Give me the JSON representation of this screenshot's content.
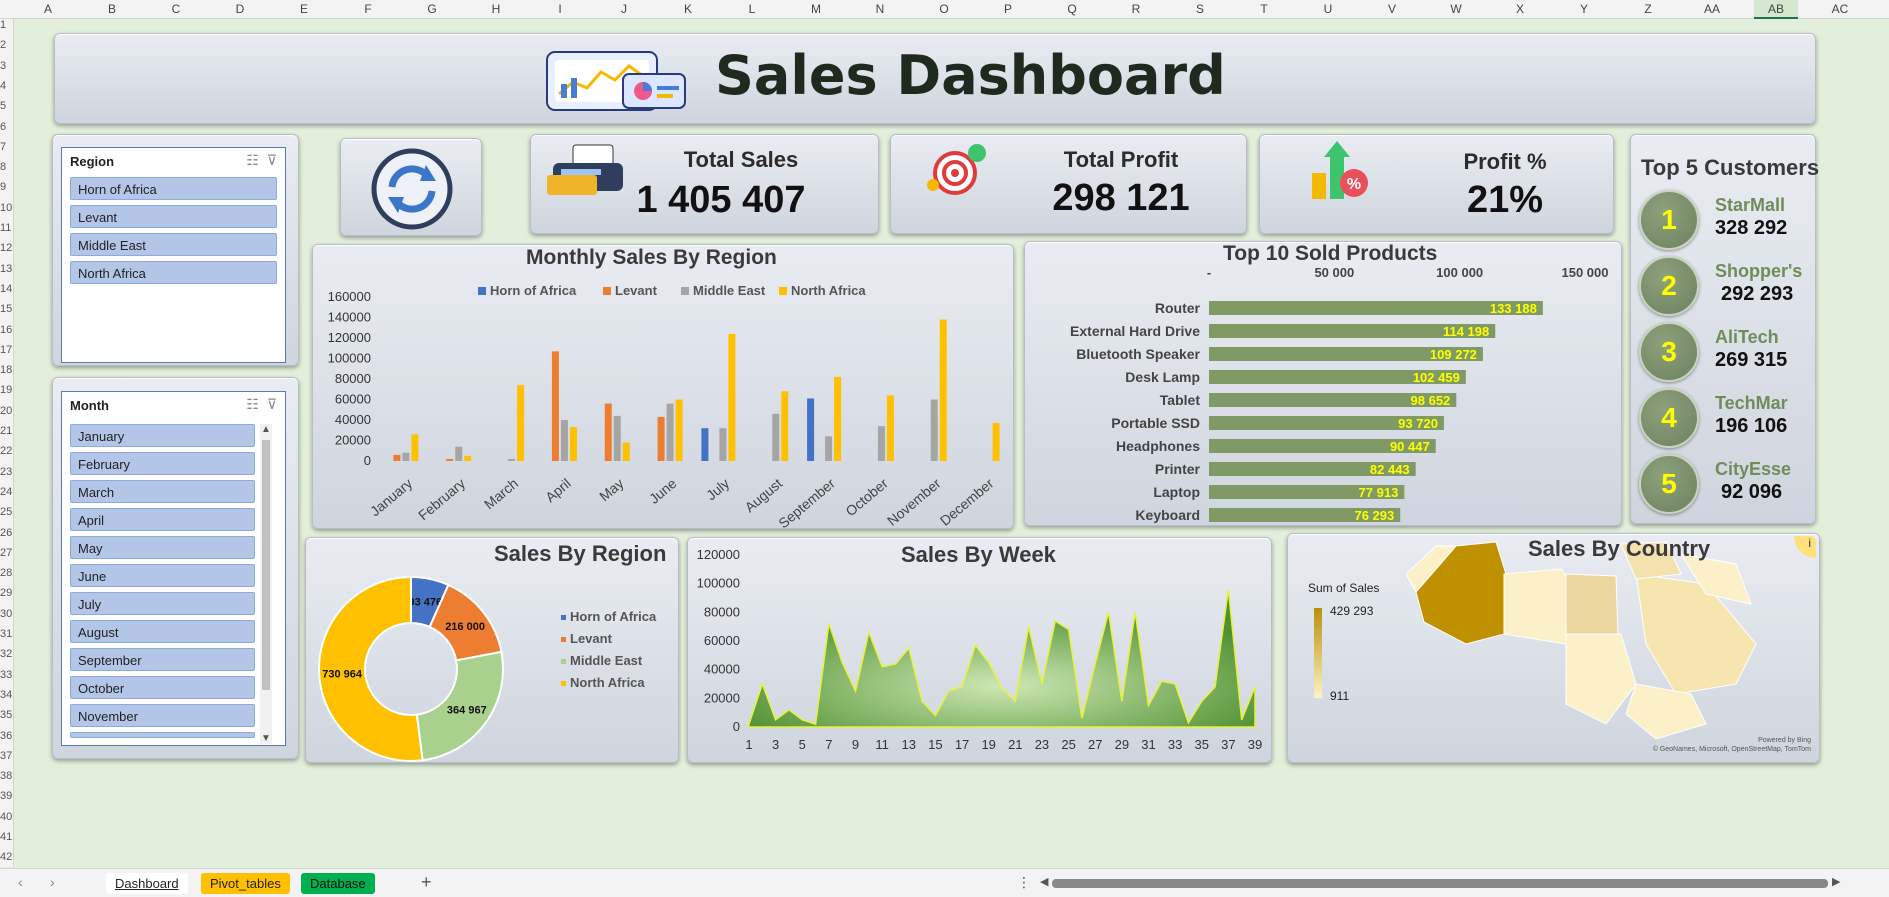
{
  "sheet": {
    "columns": [
      "A",
      "B",
      "C",
      "D",
      "E",
      "F",
      "G",
      "H",
      "I",
      "J",
      "K",
      "L",
      "M",
      "N",
      "O",
      "P",
      "Q",
      "R",
      "S",
      "T",
      "U",
      "V",
      "W",
      "X",
      "Y",
      "Z",
      "AA",
      "AB",
      "AC"
    ],
    "active_column": "AB",
    "rows": [
      "1",
      "2",
      "3",
      "4",
      "5",
      "6",
      "7",
      "8",
      "9",
      "10",
      "11",
      "12",
      "13",
      "14",
      "15",
      "16",
      "17",
      "18",
      "19",
      "20",
      "21",
      "22",
      "23",
      "24",
      "25",
      "26",
      "27",
      "28",
      "29",
      "30",
      "31",
      "32",
      "33",
      "34",
      "35",
      "36",
      "37",
      "38",
      "39",
      "40",
      "41",
      "42"
    ],
    "tabs": [
      {
        "label": "Dashboard",
        "active": true
      },
      {
        "label": "Pivot_tables",
        "color": "#ffc000"
      },
      {
        "label": "Database",
        "color": "#00b050"
      }
    ],
    "add_tab": "+",
    "nav_prev": "‹",
    "nav_next": "›",
    "more": "⋮"
  },
  "header": {
    "title": "Sales Dashboard"
  },
  "region_slicer": {
    "title": "Region",
    "items": [
      "Horn of Africa",
      "Levant",
      "Middle East",
      "North Africa"
    ]
  },
  "month_slicer": {
    "title": "Month",
    "items": [
      "January",
      "February",
      "March",
      "April",
      "May",
      "June",
      "July",
      "August",
      "September",
      "October",
      "November"
    ]
  },
  "kpis": {
    "total_sales": {
      "label": "Total Sales",
      "value": "1 405 407"
    },
    "total_profit": {
      "label": "Total Profit",
      "value": "298 121"
    },
    "profit_pct": {
      "label": "Profit %",
      "value": "21%"
    }
  },
  "top_customers": {
    "title": "Top 5 Customers",
    "items": [
      {
        "rank": "1",
        "name": "StarMall",
        "value": "328 292"
      },
      {
        "rank": "2",
        "name": "Shopper's",
        "value": "292 293"
      },
      {
        "rank": "3",
        "name": "AliTech",
        "value": "269 315"
      },
      {
        "rank": "4",
        "name": "TechMar",
        "value": "196 106"
      },
      {
        "rank": "5",
        "name": "CityEsse",
        "value": "92 096"
      }
    ]
  },
  "colors": {
    "horn": "#4472c4",
    "levant": "#ed7d31",
    "middle_east": "#a5a5a5",
    "north_africa": "#ffc000",
    "product_bar": "#7f9a65",
    "product_label": "#ffff00"
  },
  "chart_data": [
    {
      "id": "monthly",
      "type": "bar",
      "title": "Monthly Sales By Region",
      "categories": [
        "January",
        "February",
        "March",
        "April",
        "May",
        "June",
        "July",
        "August",
        "September",
        "October",
        "November",
        "December"
      ],
      "series": [
        {
          "name": "Horn of Africa",
          "values": [
            0,
            0,
            0,
            0,
            0,
            0,
            32000,
            0,
            61000,
            0,
            0,
            0
          ]
        },
        {
          "name": "Levant",
          "values": [
            6000,
            2000,
            0,
            107000,
            56000,
            43000,
            0,
            0,
            0,
            0,
            0,
            0
          ]
        },
        {
          "name": "Middle East",
          "values": [
            8000,
            14000,
            2000,
            40000,
            44000,
            56000,
            32000,
            46000,
            24000,
            34000,
            60000,
            0
          ]
        },
        {
          "name": "North Africa",
          "values": [
            26000,
            5000,
            74000,
            33000,
            18000,
            60000,
            124000,
            68000,
            82000,
            64000,
            138000,
            37000
          ]
        }
      ],
      "yticks": [
        "160000",
        "140000",
        "120000",
        "100000",
        "80000",
        "60000",
        "40000",
        "20000",
        "0"
      ],
      "ylim": [
        0,
        160000
      ],
      "legend": "top"
    },
    {
      "id": "products",
      "type": "bar",
      "orientation": "horizontal",
      "title": "Top 10 Sold Products",
      "categories": [
        "Router",
        "External Hard Drive",
        "Bluetooth Speaker",
        "Desk Lamp",
        "Tablet",
        "Portable SSD",
        "Headphones",
        "Printer",
        "Laptop",
        "Keyboard"
      ],
      "values": [
        133188,
        114198,
        109272,
        102459,
        98652,
        93720,
        90447,
        82443,
        77913,
        76293
      ],
      "labels": [
        "133 188",
        "114 198",
        "109 272",
        "102 459",
        "98 652",
        "93 720",
        "90 447",
        "82 443",
        "77 913",
        "76 293"
      ],
      "xticks": [
        "-",
        "50 000",
        "100 000",
        "150 000"
      ],
      "xlim": [
        0,
        150000
      ]
    },
    {
      "id": "region_donut",
      "type": "pie",
      "title": "Sales By Region",
      "categories": [
        "Horn of Africa",
        "Levant",
        "Middle East",
        "North Africa"
      ],
      "values": [
        93476,
        216000,
        364967,
        730964
      ],
      "labels": [
        "93 476",
        "216 000",
        "364 967",
        "730 964"
      ],
      "legend": "right"
    },
    {
      "id": "weekly",
      "type": "area",
      "title": "Sales By Week",
      "x": [
        1,
        2,
        3,
        4,
        5,
        6,
        7,
        8,
        9,
        10,
        11,
        12,
        13,
        14,
        15,
        16,
        17,
        18,
        19,
        20,
        21,
        22,
        23,
        24,
        25,
        26,
        27,
        28,
        29,
        30,
        31,
        32,
        33,
        34,
        35,
        36,
        37,
        38,
        39
      ],
      "values": [
        2000,
        30000,
        5000,
        12000,
        5000,
        2000,
        72000,
        45000,
        25000,
        66000,
        42000,
        44000,
        55000,
        18000,
        8000,
        25000,
        28000,
        57000,
        45000,
        27000,
        18000,
        70000,
        30000,
        74000,
        68000,
        6000,
        44000,
        80000,
        18000,
        80000,
        15000,
        32000,
        30000,
        3000,
        18000,
        28000,
        96000,
        5000,
        28000
      ],
      "xticks": [
        "1",
        "3",
        "5",
        "7",
        "9",
        "11",
        "13",
        "15",
        "17",
        "19",
        "21",
        "23",
        "25",
        "27",
        "29",
        "31",
        "33",
        "35",
        "37",
        "39"
      ],
      "yticks": [
        "120000",
        "100000",
        "80000",
        "60000",
        "40000",
        "20000",
        "0"
      ],
      "ylim": [
        0,
        120000
      ]
    }
  ],
  "map": {
    "title": "Sales By Country",
    "legend_title": "Sum of Sales",
    "max": "429 293",
    "min": "911",
    "credit1": "Powered by Bing",
    "credit2": "© GeoNames, Microsoft, OpenStreetMap, TomTom",
    "info": "i"
  }
}
